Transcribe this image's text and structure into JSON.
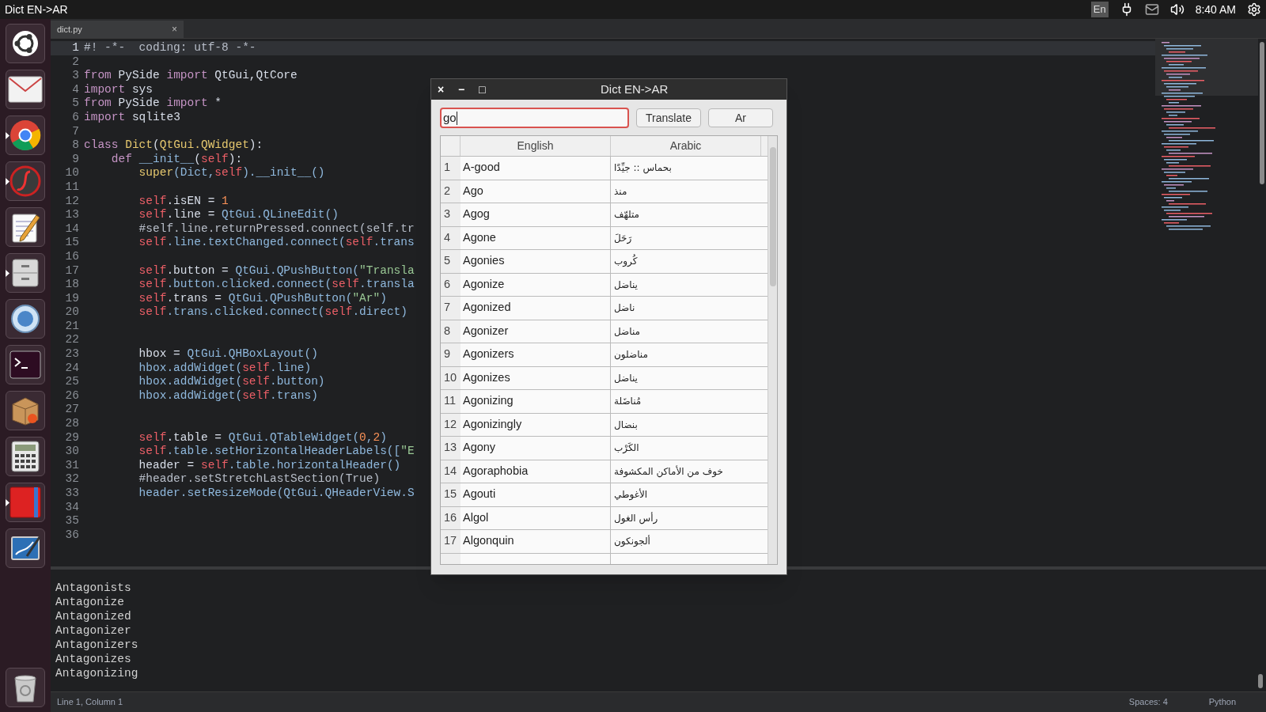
{
  "top_bar": {
    "title": "Dict EN->AR",
    "keyboard": "En",
    "clock": "8:40 AM"
  },
  "launcher": [
    {
      "kind": "ubuntu",
      "running": false
    },
    {
      "kind": "mail",
      "running": false
    },
    {
      "kind": "browser",
      "running": true
    },
    {
      "kind": "music",
      "running": true
    },
    {
      "kind": "notepad",
      "running": false
    },
    {
      "kind": "cabinet",
      "running": true
    },
    {
      "kind": "globe",
      "running": false
    },
    {
      "kind": "terminal",
      "running": false
    },
    {
      "kind": "package",
      "running": false
    },
    {
      "kind": "calculator",
      "running": false
    },
    {
      "kind": "book",
      "running": true
    },
    {
      "kind": "drawing",
      "running": false
    }
  ],
  "trash": {
    "kind": "trash"
  },
  "tabs": [
    {
      "label": "dict.py",
      "selected": true,
      "close": "×"
    }
  ],
  "code_lines": [
    {
      "number": "1",
      "current": true,
      "tokens": [
        {
          "kind": "comment",
          "text": "#! -*-  coding: utf-8 -*-"
        }
      ]
    },
    {
      "number": "2",
      "current": false
    },
    {
      "number": "3",
      "current": false,
      "tokens": [
        {
          "kind": "keyword",
          "text": "from"
        },
        {
          "kind": "plain",
          "text": " PySide "
        },
        {
          "kind": "keyword",
          "text": "import"
        },
        {
          "kind": "plain",
          "text": " QtGui,QtCore"
        }
      ]
    },
    {
      "number": "4",
      "current": false,
      "tokens": [
        {
          "kind": "keyword",
          "text": "import"
        },
        {
          "kind": "plain",
          "text": " sys"
        }
      ]
    },
    {
      "number": "5",
      "current": false,
      "tokens": [
        {
          "kind": "keyword",
          "text": "from"
        },
        {
          "kind": "plain",
          "text": " PySide "
        },
        {
          "kind": "keyword",
          "text": "import"
        },
        {
          "kind": "plain",
          "text": " *"
        }
      ]
    },
    {
      "number": "6",
      "current": false,
      "tokens": [
        {
          "kind": "keyword",
          "text": "import"
        },
        {
          "kind": "plain",
          "text": " sqlite3"
        }
      ]
    },
    {
      "number": "7",
      "current": false
    },
    {
      "number": "8",
      "current": false,
      "tokens": [
        {
          "kind": "keyword",
          "text": "class "
        },
        {
          "kind": "class",
          "text": "Dict"
        },
        {
          "kind": "plain",
          "text": "("
        },
        {
          "kind": "class",
          "text": "QtGui.QWidget"
        },
        {
          "kind": "plain",
          "text": "):"
        }
      ]
    },
    {
      "number": "9",
      "current": false,
      "tokens": [
        {
          "kind": "keyword",
          "text": "    def "
        },
        {
          "kind": "call",
          "text": "__init__"
        },
        {
          "kind": "plain",
          "text": "("
        },
        {
          "kind": "self",
          "text": "self"
        },
        {
          "kind": "plain",
          "text": "):"
        }
      ]
    },
    {
      "number": "10",
      "current": false,
      "tokens": [
        {
          "kind": "class",
          "text": "        super"
        },
        {
          "kind": "call",
          "text": "(Dict,"
        },
        {
          "kind": "self",
          "text": "self"
        },
        {
          "kind": "call",
          "text": ").__init__()"
        }
      ]
    },
    {
      "number": "11",
      "current": false
    },
    {
      "number": "12",
      "current": false,
      "tokens": [
        {
          "kind": "self",
          "text": "        self"
        },
        {
          "kind": "plain",
          "text": ".isEN = "
        },
        {
          "kind": "number",
          "text": "1"
        }
      ]
    },
    {
      "number": "13",
      "current": false,
      "tokens": [
        {
          "kind": "self",
          "text": "        self"
        },
        {
          "kind": "plain",
          "text": ".line = "
        },
        {
          "kind": "call",
          "text": "QtGui.QLineEdit()"
        }
      ]
    },
    {
      "number": "14",
      "current": false,
      "tokens": [
        {
          "kind": "comment",
          "text": "        #self.line.returnPressed.connect(self.tr"
        }
      ]
    },
    {
      "number": "15",
      "current": false,
      "tokens": [
        {
          "kind": "self",
          "text": "        self"
        },
        {
          "kind": "call",
          "text": ".line.textChanged.connect("
        },
        {
          "kind": "self",
          "text": "self"
        },
        {
          "kind": "call",
          "text": ".trans"
        }
      ]
    },
    {
      "number": "16",
      "current": false
    },
    {
      "number": "17",
      "current": false,
      "tokens": [
        {
          "kind": "self",
          "text": "        self"
        },
        {
          "kind": "plain",
          "text": ".button = "
        },
        {
          "kind": "call",
          "text": "QtGui.QPushButton("
        },
        {
          "kind": "string",
          "text": "\"Transla"
        }
      ]
    },
    {
      "number": "18",
      "current": false,
      "tokens": [
        {
          "kind": "self",
          "text": "        self"
        },
        {
          "kind": "call",
          "text": ".button.clicked.connect("
        },
        {
          "kind": "self",
          "text": "self"
        },
        {
          "kind": "call",
          "text": ".transla"
        }
      ]
    },
    {
      "number": "19",
      "current": false,
      "tokens": [
        {
          "kind": "self",
          "text": "        self"
        },
        {
          "kind": "plain",
          "text": ".trans = "
        },
        {
          "kind": "call",
          "text": "QtGui.QPushButton("
        },
        {
          "kind": "string",
          "text": "\"Ar\""
        },
        {
          "kind": "call",
          "text": ")"
        }
      ]
    },
    {
      "number": "20",
      "current": false,
      "tokens": [
        {
          "kind": "self",
          "text": "        self"
        },
        {
          "kind": "call",
          "text": ".trans.clicked.connect("
        },
        {
          "kind": "self",
          "text": "self"
        },
        {
          "kind": "call",
          "text": ".direct)"
        }
      ]
    },
    {
      "number": "21",
      "current": false
    },
    {
      "number": "22",
      "current": false
    },
    {
      "number": "23",
      "current": false,
      "tokens": [
        {
          "kind": "plain",
          "text": "        hbox = "
        },
        {
          "kind": "call",
          "text": "QtGui.QHBoxLayout()"
        }
      ]
    },
    {
      "number": "24",
      "current": false,
      "tokens": [
        {
          "kind": "call",
          "text": "        hbox.addWidget("
        },
        {
          "kind": "self",
          "text": "self"
        },
        {
          "kind": "call",
          "text": ".line)"
        }
      ]
    },
    {
      "number": "25",
      "current": false,
      "tokens": [
        {
          "kind": "call",
          "text": "        hbox.addWidget("
        },
        {
          "kind": "self",
          "text": "self"
        },
        {
          "kind": "call",
          "text": ".button)"
        }
      ]
    },
    {
      "number": "26",
      "current": false,
      "tokens": [
        {
          "kind": "call",
          "text": "        hbox.addWidget("
        },
        {
          "kind": "self",
          "text": "self"
        },
        {
          "kind": "call",
          "text": ".trans)"
        }
      ]
    },
    {
      "number": "27",
      "current": false
    },
    {
      "number": "28",
      "current": false
    },
    {
      "number": "29",
      "current": false,
      "tokens": [
        {
          "kind": "self",
          "text": "        self"
        },
        {
          "kind": "plain",
          "text": ".table = "
        },
        {
          "kind": "call",
          "text": "QtGui.QTableWidget("
        },
        {
          "kind": "number",
          "text": "0"
        },
        {
          "kind": "call",
          "text": ","
        },
        {
          "kind": "number",
          "text": "2"
        },
        {
          "kind": "call",
          "text": ")"
        }
      ]
    },
    {
      "number": "30",
      "current": false,
      "tokens": [
        {
          "kind": "self",
          "text": "        self"
        },
        {
          "kind": "call",
          "text": ".table.setHorizontalHeaderLabels(["
        },
        {
          "kind": "string",
          "text": "\"E"
        }
      ]
    },
    {
      "number": "31",
      "current": false,
      "tokens": [
        {
          "kind": "plain",
          "text": "        header = "
        },
        {
          "kind": "self",
          "text": "self"
        },
        {
          "kind": "call",
          "text": ".table.horizontalHeader()"
        }
      ]
    },
    {
      "number": "32",
      "current": false,
      "tokens": [
        {
          "kind": "comment",
          "text": "        #header.setStretchLastSection(True)"
        }
      ]
    },
    {
      "number": "33",
      "current": false,
      "tokens": [
        {
          "kind": "call",
          "text": "        header.setResizeMode(QtGui.QHeaderView.S"
        }
      ]
    },
    {
      "number": "34",
      "current": false
    },
    {
      "number": "35",
      "current": false
    },
    {
      "number": "36",
      "current": false
    }
  ],
  "console_lines": [
    "Antagonists",
    "Antagonize",
    "Antagonized",
    "Antagonizer",
    "Antagonizers",
    "Antagonizes",
    "Antagonizing"
  ],
  "status_bar": {
    "position": "Line 1, Column 1",
    "spaces": "Spaces: 4",
    "language": "Python"
  },
  "dialog": {
    "title": "Dict EN->AR",
    "controls": [
      "×",
      "−",
      "□"
    ],
    "search": {
      "value": "go"
    },
    "buttons": [
      "Translate",
      "Ar"
    ],
    "table": {
      "columns": [
        "English",
        "Arabic"
      ],
      "rows": [
        {
          "number": "1",
          "english": "A-good",
          "arabic": "بحماس :: جيِّدًا"
        },
        {
          "number": "2",
          "english": "Ago",
          "arabic": "منذ"
        },
        {
          "number": "3",
          "english": "Agog",
          "arabic": "متلهّف"
        },
        {
          "number": "4",
          "english": "Agone",
          "arabic": "رَحَلَ"
        },
        {
          "number": "5",
          "english": "Agonies",
          "arabic": "كُروب"
        },
        {
          "number": "6",
          "english": "Agonize",
          "arabic": "يناضل"
        },
        {
          "number": "7",
          "english": "Agonized",
          "arabic": "ناضل"
        },
        {
          "number": "8",
          "english": "Agonizer",
          "arabic": "مناضل"
        },
        {
          "number": "9",
          "english": "Agonizers",
          "arabic": "مناضلون"
        },
        {
          "number": "10",
          "english": "Agonizes",
          "arabic": "يناضل"
        },
        {
          "number": "11",
          "english": "Agonizing",
          "arabic": "مُناضَلة"
        },
        {
          "number": "12",
          "english": "Agonizingly",
          "arabic": "بنضال"
        },
        {
          "number": "13",
          "english": "Agony",
          "arabic": "الكَرْب"
        },
        {
          "number": "14",
          "english": "Agoraphobia",
          "arabic": "خوف من الأماكن المكشوفة"
        },
        {
          "number": "15",
          "english": "Agouti",
          "arabic": "الأغوطي"
        },
        {
          "number": "16",
          "english": "Algol",
          "arabic": "رأس الغول"
        },
        {
          "number": "17",
          "english": "Algonquin",
          "arabic": "ألجونكون"
        }
      ]
    }
  }
}
